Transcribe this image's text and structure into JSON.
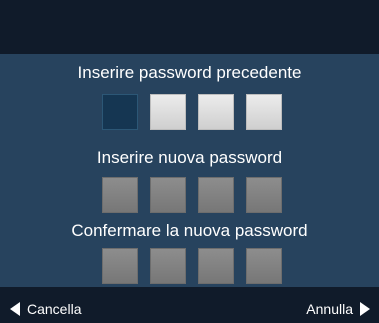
{
  "labels": {
    "old_password": "Inserire password precedente",
    "new_password": "Inserire nuova password",
    "confirm_password": "Confermare la nuova password"
  },
  "footer": {
    "left_label": "Cancella",
    "right_label": "Annulla",
    "left_icon": "left-arrow-icon",
    "right_icon": "right-arrow-icon"
  },
  "pin_groups": {
    "old_password": [
      "active",
      "enabled",
      "enabled",
      "enabled"
    ],
    "new_password": [
      "disabled",
      "disabled",
      "disabled",
      "disabled"
    ],
    "confirm_password": [
      "disabled",
      "disabled",
      "disabled",
      "disabled"
    ]
  },
  "colors": {
    "background": "#27435e",
    "top_bar": "#101b2a",
    "bottom_bar": "#101b2a",
    "active_slot": "#153652",
    "enabled_slot": "#e3e3e3",
    "disabled_slot": "#858585",
    "text": "#ffffff"
  }
}
